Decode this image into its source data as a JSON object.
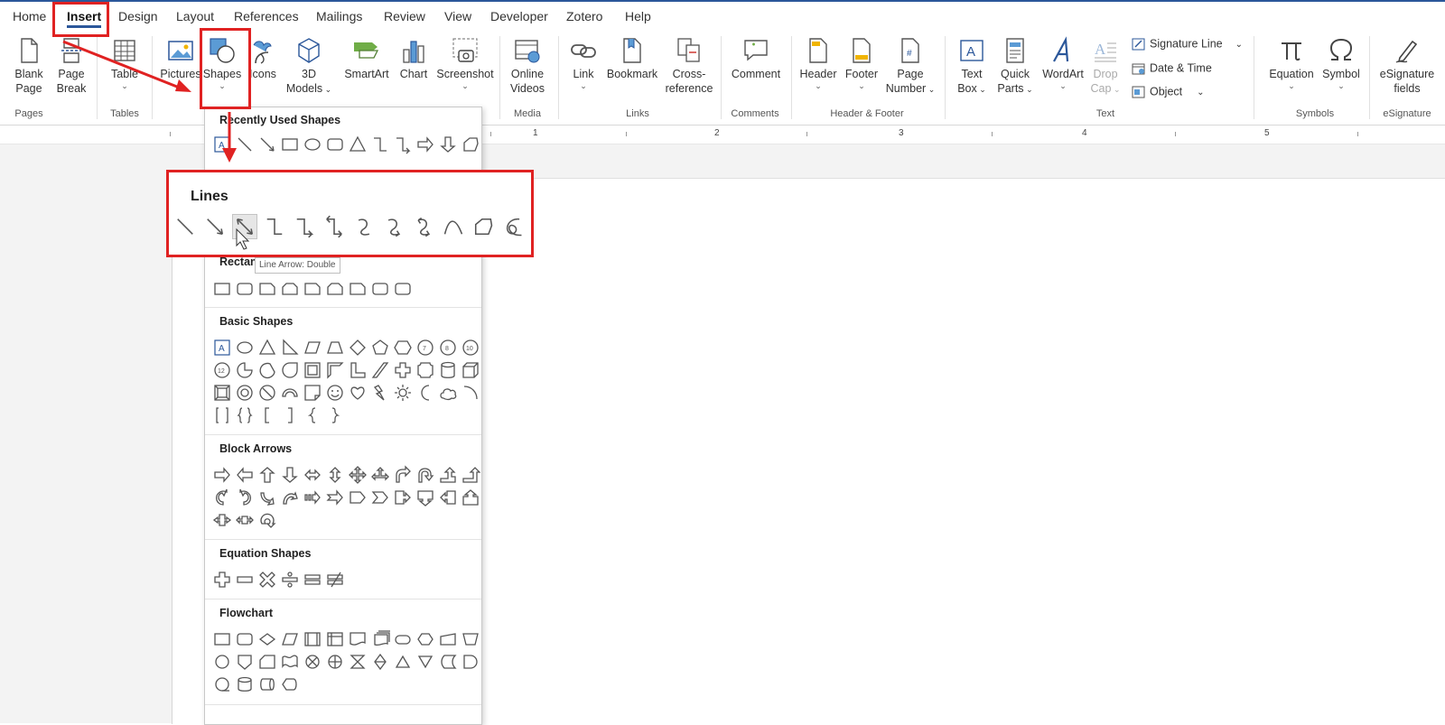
{
  "colors": {
    "accent": "#2b579a",
    "annotation": "#e02222"
  },
  "tabs": [
    "Home",
    "Insert",
    "Design",
    "Layout",
    "References",
    "Mailings",
    "Review",
    "View",
    "Developer",
    "Zotero",
    "Help"
  ],
  "active_tab": "Insert",
  "ribbon": {
    "blank_page": [
      "Blank",
      "Page"
    ],
    "page_break": [
      "Page",
      "Break"
    ],
    "table": "Table",
    "pictures": "Pictures",
    "shapes": "Shapes",
    "icons": "Icons",
    "models3d": [
      "3D",
      "Models"
    ],
    "smartart": "SmartArt",
    "chart": "Chart",
    "screenshot": "Screenshot",
    "online_videos": [
      "Online",
      "Videos"
    ],
    "link": "Link",
    "bookmark": "Bookmark",
    "cross_reference": [
      "Cross-",
      "reference"
    ],
    "comment": "Comment",
    "header": "Header",
    "footer": "Footer",
    "page_number": [
      "Page",
      "Number"
    ],
    "text_box": [
      "Text",
      "Box"
    ],
    "quick_parts": [
      "Quick",
      "Parts"
    ],
    "wordart": "WordArt",
    "drop_cap": [
      "Drop",
      "Cap"
    ],
    "signature_line": "Signature Line",
    "date_time": "Date & Time",
    "object": "Object",
    "equation": "Equation",
    "symbol": "Symbol",
    "esignature": [
      "eSignature",
      "fields"
    ]
  },
  "groups": [
    "Pages",
    "Tables",
    "Media",
    "Links",
    "Comments",
    "Header & Footer",
    "Text",
    "Symbols",
    "eSignature"
  ],
  "ruler_numbers": [
    "1",
    "2",
    "3",
    "4",
    "5"
  ],
  "gallery": {
    "recently_used": "Recently Used Shapes",
    "rectangles": "Rectangles",
    "basic_shapes": "Basic Shapes",
    "block_arrows": "Block Arrows",
    "equation_shapes": "Equation Shapes",
    "flowchart": "Flowchart"
  },
  "callout_title": "Lines",
  "tooltip": "Line Arrow: Double"
}
